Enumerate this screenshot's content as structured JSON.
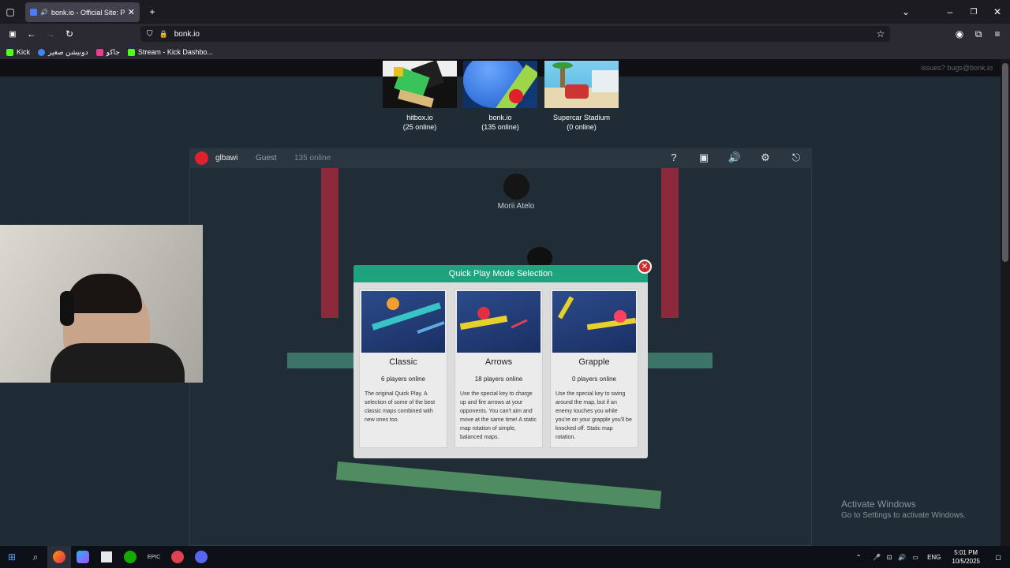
{
  "browser": {
    "tab_title": "bonk.io - Official Site: Play",
    "url": "bonk.io",
    "bookmarks": [
      {
        "label": "Kick",
        "color": "#53fc18"
      },
      {
        "label": "دونيشن صغير",
        "color": "#4285f4"
      },
      {
        "label": "جاكو",
        "color": "#e83e8c"
      },
      {
        "label": "Stream - Kick Dashbo...",
        "color": "#53fc18"
      }
    ]
  },
  "page": {
    "issues_link": "issues? bugs@bonk.io",
    "games": [
      {
        "name": "hitbox.io",
        "online": "(25 online)"
      },
      {
        "name": "bonk.io",
        "online": "(135 online)"
      },
      {
        "name": "Supercar Stadium",
        "online": "(0 online)"
      }
    ]
  },
  "game": {
    "username": "glbawi",
    "account_type": "Guest",
    "online_count": "135 online",
    "player_name": "Morii Atelo"
  },
  "modal": {
    "title": "Quick Play Mode Selection",
    "modes": [
      {
        "name": "Classic",
        "online": "6 players online",
        "description": "The original Quick Play. A selection of some of the best classic maps combined with new ones too."
      },
      {
        "name": "Arrows",
        "online": "18 players online",
        "description": "Use the special key to charge up and fire arrows at your opponents. You can't aim and move at the same time! A static map rotation of simple, balanced maps."
      },
      {
        "name": "Grapple",
        "online": "0 players online",
        "description": "Use the special key to swing around the map, but if an enemy touches you while you're on your grapple you'll be knocked off. Static map rotation."
      }
    ]
  },
  "windows": {
    "activate_title": "Activate Windows",
    "activate_sub": "Go to Settings to activate Windows.",
    "time": "5:01 PM",
    "date": "10/5/2025",
    "lang": "ENG"
  }
}
